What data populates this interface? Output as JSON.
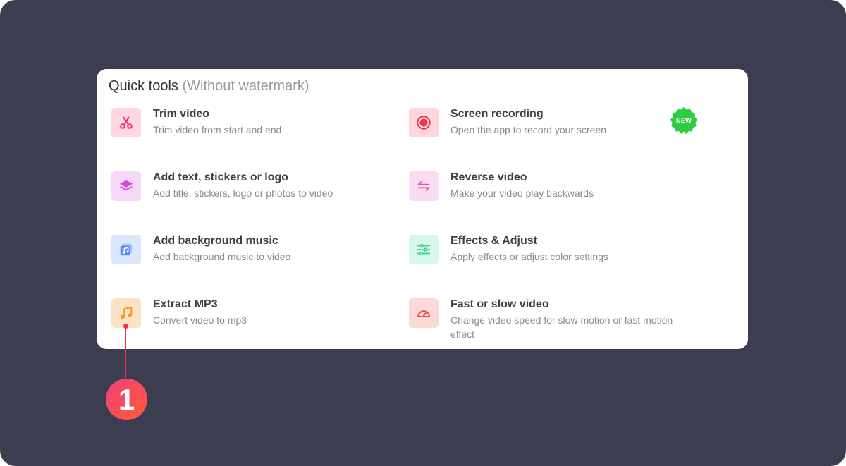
{
  "panel": {
    "title": "Quick tools",
    "subtitle": "(Without watermark)"
  },
  "tools": [
    {
      "title": "Trim video",
      "description": "Trim video from start and end",
      "icon": "scissors-icon",
      "icon_color": "#f0336a",
      "icon_bg": "#ffd6e2"
    },
    {
      "title": "Screen recording",
      "description": "Open the app to record your screen",
      "icon": "record-icon",
      "icon_color": "#f0334f",
      "icon_bg": "#ffd6dc",
      "badge": "NEW"
    },
    {
      "title": "Add text, stickers or logo",
      "description": "Add title, stickers, logo or photos to video",
      "icon": "layers-icon",
      "icon_color": "#d34ed6",
      "icon_bg": "#f7d8f8"
    },
    {
      "title": "Reverse video",
      "description": "Make your video play backwards",
      "icon": "reverse-icon",
      "icon_color": "#d657b8",
      "icon_bg": "#f9dcf1"
    },
    {
      "title": "Add background music",
      "description": "Add background music to video",
      "icon": "music-album-icon",
      "icon_color": "#5b8cf0",
      "icon_bg": "#dbe7fd"
    },
    {
      "title": "Effects & Adjust",
      "description": "Apply effects or adjust color settings",
      "icon": "sliders-icon",
      "icon_color": "#3fcf9a",
      "icon_bg": "#d7f7ea"
    },
    {
      "title": "Extract MP3",
      "description": "Convert video to mp3",
      "icon": "music-note-icon",
      "icon_color": "#f39a1e",
      "icon_bg": "#fde3c6"
    },
    {
      "title": "Fast or slow video",
      "description": "Change video speed for slow motion or fast motion effect",
      "icon": "speedometer-icon",
      "icon_color": "#ef4a4a",
      "icon_bg": "#fdd9d6"
    }
  ],
  "badge_color": "#2ecc40",
  "callout": {
    "number": "1",
    "color": "#e8334e"
  }
}
